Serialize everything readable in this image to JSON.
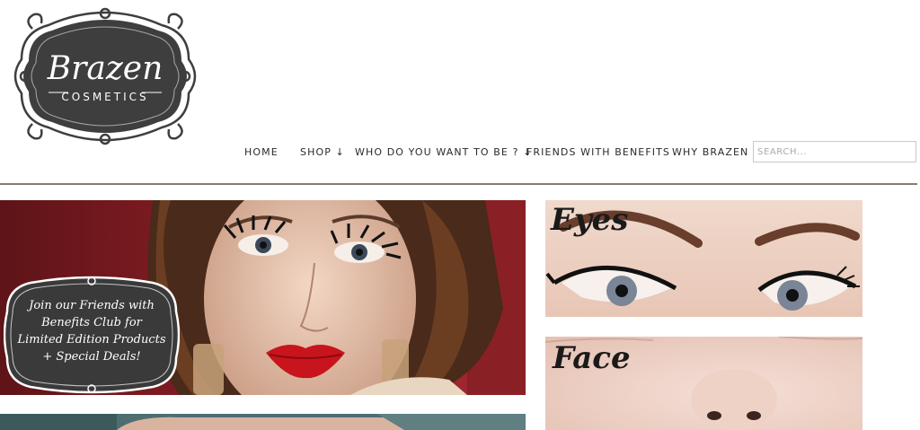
{
  "logo": {
    "brand": "Brazen",
    "sub": "COSMETICS"
  },
  "nav": {
    "items": [
      {
        "label": "HOME"
      },
      {
        "label": "SHOP ↓"
      },
      {
        "label": "WHO DO YOU WANT TO BE ? ↓"
      },
      {
        "label": "FRIENDS WITH BENEFITS"
      },
      {
        "label": "WHY BRAZEN"
      }
    ],
    "search_placeholder": "SEARCH..."
  },
  "hero": {
    "promo_line1": "Join our Friends with",
    "promo_line2": "Benefits Club for",
    "promo_line3": "Limited Edition Products",
    "promo_line4": "+ Special Deals!"
  },
  "tiles": {
    "eyes": "Eyes",
    "face": "Face"
  },
  "colors": {
    "nav_text": "#2a2a2a",
    "divider": "#8a7a6e",
    "logo_plaque": "#3e3e3e",
    "hero_red": "#8e1e26",
    "lipstick": "#c8141c"
  }
}
